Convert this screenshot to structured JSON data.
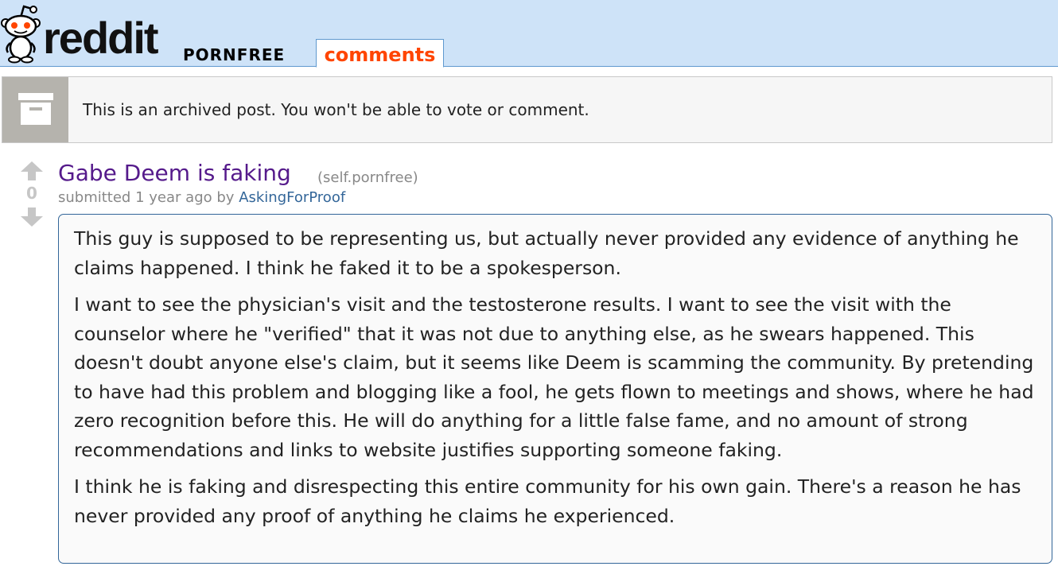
{
  "header": {
    "logo_text": "reddit",
    "subreddit": "PORNFREE",
    "active_tab": "comments",
    "colors": {
      "bar": "#cee3f8",
      "tab_text": "#ff4500"
    }
  },
  "archived_notice": {
    "icon": "archive-box-icon",
    "text": "This is an archived post. You won't be able to vote or comment."
  },
  "post": {
    "score": "0",
    "title": "Gabe Deem is faking",
    "domain": "(self.pornfree)",
    "submitted_prefix": "submitted",
    "time": "1 year ago",
    "by": "by",
    "author": "AskingForProof",
    "paragraphs": [
      "This guy is supposed to be representing us, but actually never provided any evidence of anything he claims happened. I think he faked it to be a spokesperson.",
      "I want to see the physician's visit and the testosterone results. I want to see the visit with the counselor where he \"verified\" that it was not due to anything else, as he swears happened. This doesn't doubt anyone else's claim, but it seems like Deem is scamming the community. By pretending to have had this problem and blogging like a fool, he gets flown to meetings and shows, where he had zero recognition before this. He will do anything for a little false fame, and no amount of strong recommendations and links to website justifies supporting someone faking.",
      "I think he is faking and disrespecting this entire community for his own gain. There's a reason he has never provided any proof of anything he claims he experienced."
    ]
  }
}
